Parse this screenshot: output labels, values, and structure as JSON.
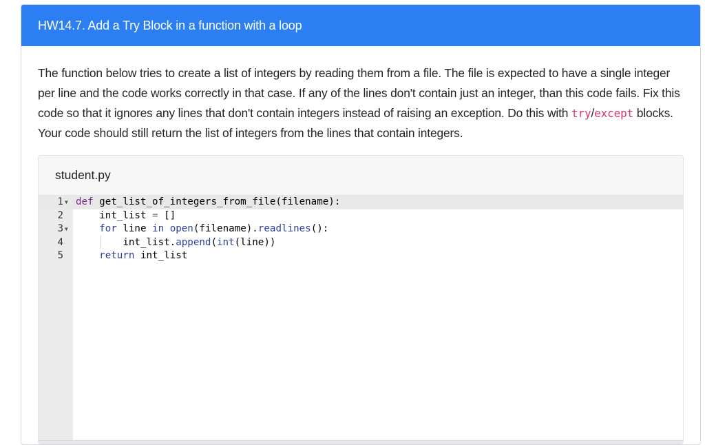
{
  "header": {
    "title": "HW14.7. Add a Try Block in a function with a loop"
  },
  "question": {
    "text_1": "The function below tries to create a list of integers by reading them from a file. The file is expected to have a single integer per line and the code works correctly in that case. If any of the lines don't contain just an integer, than this code fails. Fix this code so that it ignores any lines that don't contain integers instead of raising an exception. Do this with ",
    "code_try": "try",
    "slash": "/",
    "code_except": "except",
    "text_2": " blocks. Your code should still return the list of integers from the lines that contain integers."
  },
  "editor": {
    "filename": "student.py",
    "lines": [
      {
        "num": "1",
        "fold": "▼"
      },
      {
        "num": "2",
        "fold": ""
      },
      {
        "num": "3",
        "fold": "▼"
      },
      {
        "num": "4",
        "fold": ""
      },
      {
        "num": "5",
        "fold": ""
      }
    ],
    "code": {
      "l1_kw": "def",
      "l1_rest": " get_list_of_integers_from_file(filename):",
      "l2_indent": "    ",
      "l2_a": "int_list ",
      "l2_op": "=",
      "l2_b": " []",
      "l3_indent": "    ",
      "l3_for": "for",
      "l3_a": " line ",
      "l3_in": "in",
      "l3_sp": " ",
      "l3_open": "open",
      "l3_b": "(filename).",
      "l3_readlines": "readlines",
      "l3_c": "():",
      "l4_indent": "        ",
      "l4_a": "int_list.",
      "l4_append": "append",
      "l4_b": "(",
      "l4_int": "int",
      "l4_c": "(line))",
      "l5_indent": "    ",
      "l5_return": "return",
      "l5_a": " int_list"
    }
  },
  "colors": {
    "header_bg": "#2b7ff3",
    "code_keyword": "#2c3e9b",
    "code_def": "#7f2296",
    "inline_code": "#d6336c"
  }
}
